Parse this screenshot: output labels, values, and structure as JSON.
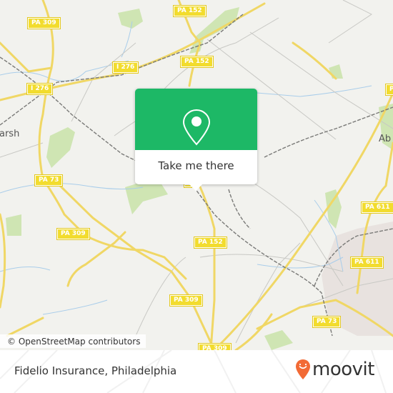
{
  "map": {
    "road_labels": [
      {
        "id": "pa309-top",
        "text": "PA 309"
      },
      {
        "id": "pa152-top",
        "text": "PA 152"
      },
      {
        "id": "i276-mid",
        "text": "I 276"
      },
      {
        "id": "pa152-mid",
        "text": "PA 152"
      },
      {
        "id": "i276-left",
        "text": "I 276"
      },
      {
        "id": "pa73-left",
        "text": "PA 73"
      },
      {
        "id": "pa309-left",
        "text": "PA 309"
      },
      {
        "id": "pa152-lower",
        "text": "PA 152"
      },
      {
        "id": "pa309-lower",
        "text": "PA 309"
      },
      {
        "id": "pa611-upper",
        "text": "PA 611"
      },
      {
        "id": "pa611-lower",
        "text": "PA 611"
      },
      {
        "id": "pa73-right",
        "text": "PA 73"
      },
      {
        "id": "pa309-bottom",
        "text": "PA 309"
      }
    ],
    "place_labels": [
      {
        "id": "marsh",
        "text": "arsh"
      },
      {
        "id": "abington",
        "text": "Ab"
      }
    ],
    "attribution": "© OpenStreetMap contributors"
  },
  "popup": {
    "icon": "map-pin-icon",
    "button_label": "Take me there",
    "color": "#1db866"
  },
  "footer": {
    "place_name": "Fidelio Insurance, Philadelphia",
    "brand": "moovit",
    "brand_color": "#f26a35"
  }
}
